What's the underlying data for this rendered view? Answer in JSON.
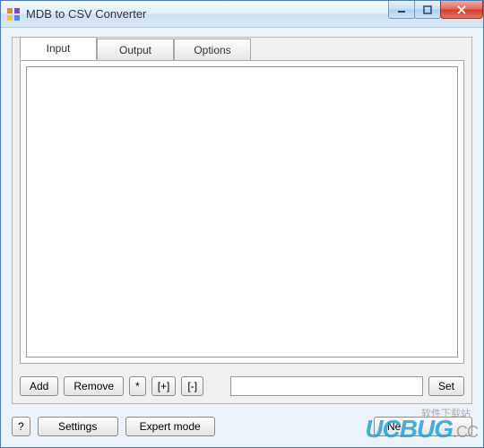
{
  "window": {
    "title": "MDB to CSV Converter"
  },
  "tabs": {
    "input": "Input",
    "output": "Output",
    "options": "Options"
  },
  "buttons": {
    "add": "Add",
    "remove": "Remove",
    "star": "*",
    "expand": "[+]",
    "collapse": "[-]",
    "set": "Set",
    "help": "?",
    "settings": "Settings",
    "expert": "Expert mode",
    "next": "Ne"
  },
  "fields": {
    "path": ""
  },
  "watermark": {
    "sub": "软件下载站",
    "main": "UCBUG",
    "suffix": ".CC"
  }
}
